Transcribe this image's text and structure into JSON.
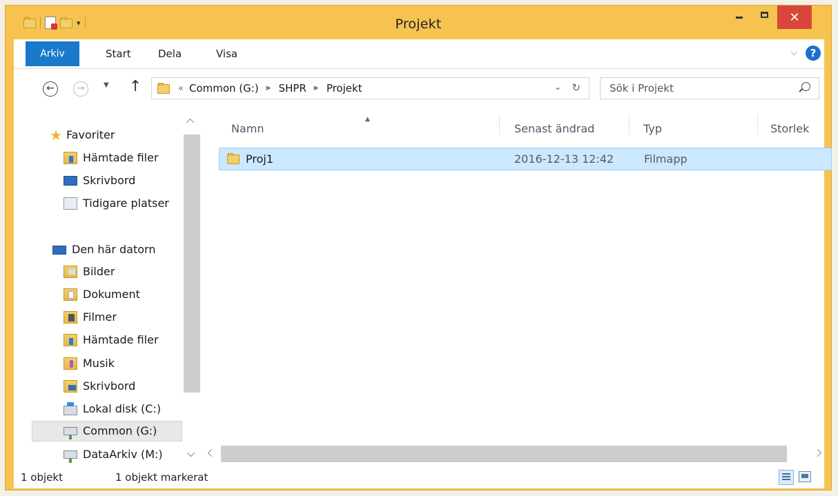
{
  "window": {
    "title": "Projekt"
  },
  "ribbon": {
    "tabs": [
      {
        "label": "Arkiv"
      },
      {
        "label": "Start"
      },
      {
        "label": "Dela"
      },
      {
        "label": "Visa"
      }
    ]
  },
  "address": {
    "crumbs": [
      "Common (G:)",
      "SHPR",
      "Projekt"
    ],
    "prefix": "«"
  },
  "search": {
    "placeholder": "Sök i Projekt"
  },
  "nav": {
    "favorites": {
      "label": "Favoriter",
      "items": [
        {
          "label": "Hämtade filer"
        },
        {
          "label": "Skrivbord"
        },
        {
          "label": "Tidigare platser"
        }
      ]
    },
    "computer": {
      "label": "Den här datorn",
      "items": [
        {
          "label": "Bilder"
        },
        {
          "label": "Dokument"
        },
        {
          "label": "Filmer"
        },
        {
          "label": "Hämtade filer"
        },
        {
          "label": "Musik"
        },
        {
          "label": "Skrivbord"
        },
        {
          "label": "Lokal disk (C:)"
        },
        {
          "label": "Common (G:)"
        },
        {
          "label": "DataArkiv (M:)"
        }
      ]
    }
  },
  "columns": {
    "name": "Namn",
    "modified": "Senast ändrad",
    "type": "Typ",
    "size": "Storlek"
  },
  "files": [
    {
      "name": "Proj1",
      "modified": "2016-12-13 12:42",
      "type": "Filmapp"
    }
  ],
  "status": {
    "count": "1 objekt",
    "selected": "1 objekt markerat"
  }
}
